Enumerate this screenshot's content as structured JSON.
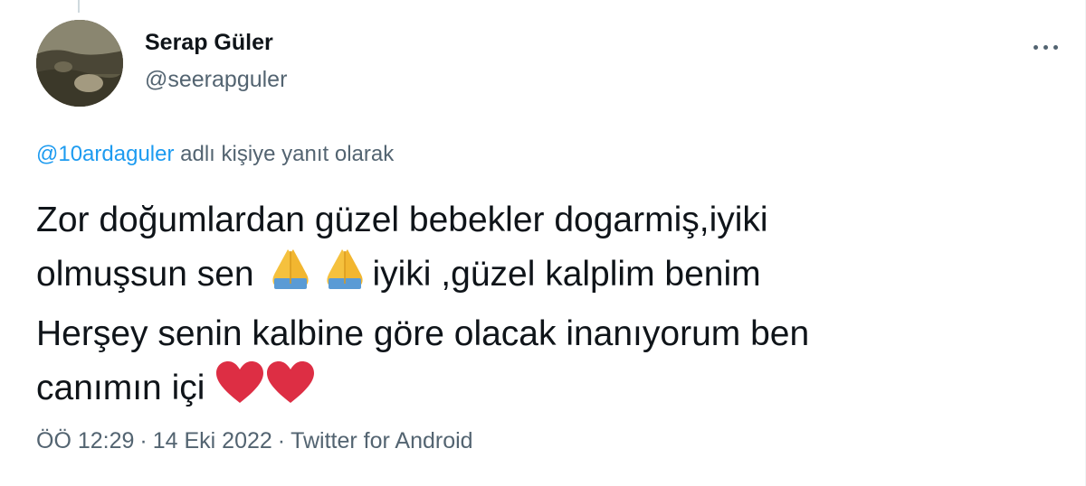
{
  "author": {
    "display_name": "Serap Güler",
    "handle": "@seerapguler"
  },
  "reply": {
    "mention": "@10ardaguler",
    "suffix": " adlı kişiye yanıt olarak"
  },
  "tweet": {
    "line1": "Zor doğumlardan güzel bebekler dogarmiş,iyiki",
    "line2_before": "olmuşsun sen ",
    "line2_after": "iyiki ,güzel kalplim benim",
    "line3": "Herşey senin kalbine göre olacak inanıyorum ben",
    "line4": "canımın içi "
  },
  "emojis": [
    "folded-hands",
    "folded-hands",
    "red-heart",
    "red-heart"
  ],
  "meta": {
    "time": "ÖÖ 12:29",
    "separator": "·",
    "date": "14 Eki 2022",
    "source": "Twitter for Android"
  },
  "colors": {
    "text": "#0f1419",
    "secondary": "#536471",
    "link": "#1d9bf0",
    "heart": "#e0245e"
  }
}
